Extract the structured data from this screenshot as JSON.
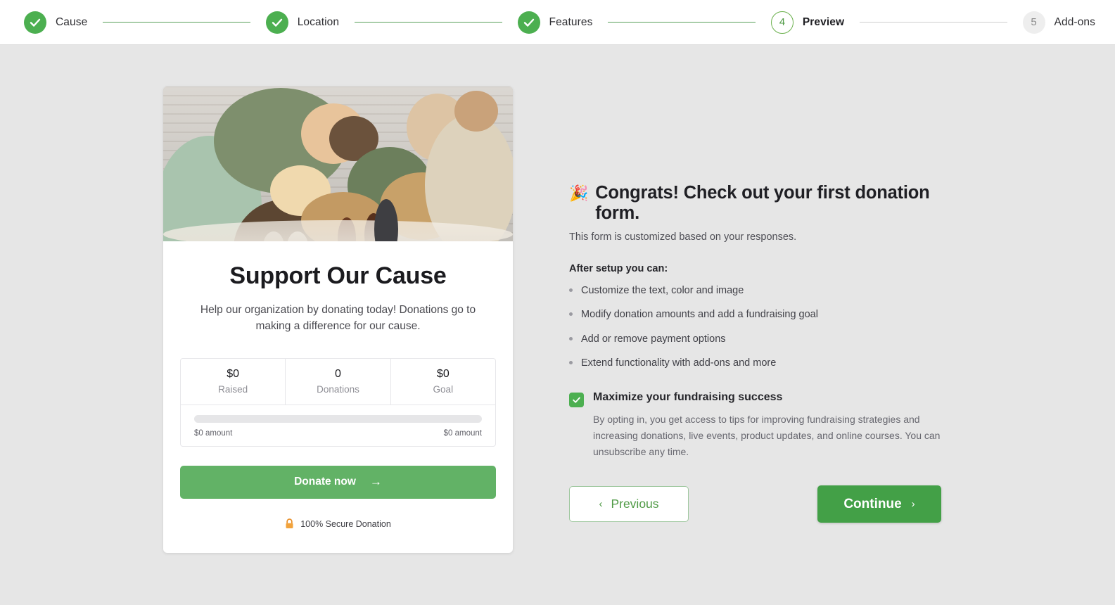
{
  "stepper": {
    "steps": [
      {
        "num": "1",
        "label": "Cause",
        "state": "done"
      },
      {
        "num": "2",
        "label": "Location",
        "state": "done"
      },
      {
        "num": "3",
        "label": "Features",
        "state": "done"
      },
      {
        "num": "4",
        "label": "Preview",
        "state": "current"
      },
      {
        "num": "5",
        "label": "Add-ons",
        "state": "todo"
      }
    ]
  },
  "form_preview": {
    "title": "Support Our Cause",
    "description": "Help our organization by donating today! Donations go to making a difference for our cause.",
    "stats": [
      {
        "value": "$0",
        "label": "Raised"
      },
      {
        "value": "0",
        "label": "Donations"
      },
      {
        "value": "$0",
        "label": "Goal"
      }
    ],
    "progress": {
      "percent": 0,
      "left_label": "$0 amount",
      "right_label": "$0 amount"
    },
    "donate_button": "Donate now",
    "donate_arrow": "→",
    "secure_text": "100% Secure Donation",
    "lock_icon": "🔒"
  },
  "panel": {
    "emoji": "🎉",
    "heading": "Congrats! Check out your first donation form.",
    "subheading": "This form is customized based on your responses.",
    "after_setup_label": "After setup you can:",
    "features": [
      "Customize the text, color and image",
      "Modify donation amounts and add a fundraising goal",
      "Add or remove payment options",
      "Extend functionality with add-ons and more"
    ],
    "optin": {
      "title": "Maximize your fundraising success",
      "description": "By opting in, you get access to tips for improving fundraising strategies and increasing donations, live events, product updates, and online courses. You can unsubscribe any time.",
      "checked": true
    },
    "previous_button": "Previous",
    "previous_chevron": "‹",
    "continue_button": "Continue",
    "continue_chevron": "›"
  },
  "colors": {
    "brand_green": "#4CAF50",
    "button_green": "#43a047",
    "donate_green": "#62b266",
    "page_bg": "#e6e6e6",
    "lock_orange": "#e8912d"
  }
}
